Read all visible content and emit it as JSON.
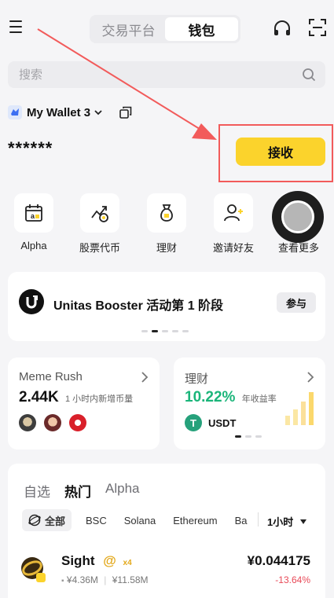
{
  "header": {
    "tabs": [
      "交易平台",
      "钱包"
    ],
    "active_tab": 1
  },
  "search": {
    "placeholder": "搜索"
  },
  "wallet": {
    "name": "My Wallet 3",
    "balance_masked": "******",
    "receive_label": "接收"
  },
  "quick_actions": [
    {
      "label": "Alpha",
      "icon": "calendar-a-icon"
    },
    {
      "label": "股票代币",
      "icon": "chart-coin-icon"
    },
    {
      "label": "理财",
      "icon": "money-bag-icon"
    },
    {
      "label": "邀请好友",
      "icon": "add-user-icon"
    },
    {
      "label": "查看更多",
      "icon": "more-icon"
    }
  ],
  "booster": {
    "title": "Unitas Booster 活动第 1 阶段",
    "join_label": "参与"
  },
  "meme_card": {
    "title": "Meme Rush",
    "value": "2.44K",
    "caption": "1 小时内新增币量"
  },
  "finance_card": {
    "title": "理财",
    "value": "10.22%",
    "caption": "年收益率",
    "asset": "USDT",
    "value_color": "#1bb57a"
  },
  "market": {
    "tabs": [
      "自选",
      "热门",
      "Alpha"
    ],
    "active_tab": 1,
    "chips": [
      "全部",
      "BSC",
      "Solana",
      "Ethereum",
      "Ba"
    ],
    "time_filter": "1小时",
    "rows": [
      {
        "name": "Sight",
        "sub1": "¥4.36M",
        "sub2": "¥11.58M",
        "price": "¥0.044175",
        "change": "-13.64%",
        "badge": "x4"
      }
    ]
  },
  "colors": {
    "accent": "#fbd32c",
    "highlight": "#f25b5b",
    "down": "#e84a58",
    "up": "#1bb57a"
  }
}
